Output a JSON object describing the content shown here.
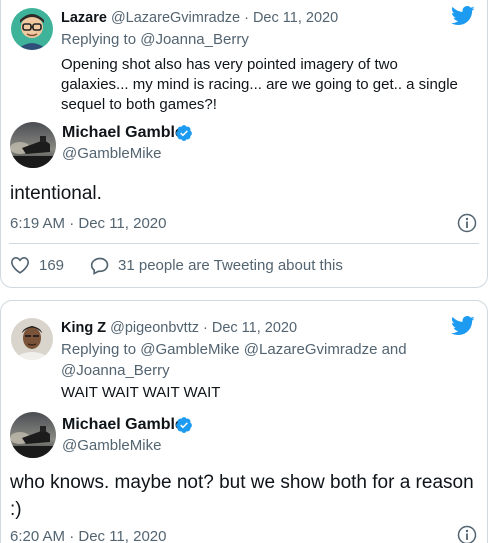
{
  "tweet1": {
    "quoted": {
      "name": "Lazare",
      "handle": "@LazareGvimradze",
      "separator": "·",
      "date": "Dec 11, 2020",
      "replying_to": "Replying to @Joanna_Berry",
      "text": "Opening shot also has very pointed imagery of two galaxies... my mind is racing... are we going to get.. a single sequel to both games?!"
    },
    "author": {
      "name": "Michael Gamble",
      "handle": "@GambleMike"
    },
    "text": "intentional.",
    "timestamp": "6:19 AM · Dec 11, 2020",
    "likes": "169",
    "conversation": "31 people are Tweeting about this"
  },
  "tweet2": {
    "quoted": {
      "name": "King Z",
      "handle": "@pigeonbvttz",
      "separator": "·",
      "date": "Dec 11, 2020",
      "replying_to": "Replying to @GambleMike @LazareGvimradze and @Joanna_Berry",
      "text": "WAIT WAIT WAIT WAIT"
    },
    "author": {
      "name": "Michael Gamble",
      "handle": "@GambleMike"
    },
    "text": "who knows. maybe not? but we show both for a reason :)",
    "timestamp": "6:20 AM · Dec 11, 2020"
  },
  "colors": {
    "twitter_blue": "#1d9bf0",
    "secondary_text": "#536471",
    "primary_text": "#0f1419",
    "border": "#cfd9de"
  },
  "icons": {
    "brand": "twitter-bird-icon",
    "verified": "verified-badge-icon",
    "info": "info-icon",
    "like": "heart-icon",
    "reply": "speech-bubble-icon"
  }
}
